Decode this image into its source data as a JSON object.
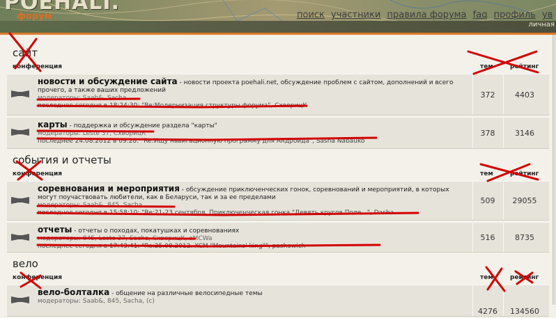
{
  "header": {
    "logo": "POEHALI.",
    "section": "форум",
    "nav": [
      "поиск",
      "участники",
      "правила форума",
      "faq",
      "профиль",
      "ув"
    ],
    "personal": "личная"
  },
  "colors": {
    "accent": "#e07b2a",
    "scribble": "#d20000"
  },
  "columns": {
    "forum": "конференция",
    "topics": "тем",
    "rating": "рейтинг"
  },
  "categories": [
    {
      "title": "сайт",
      "forums": [
        {
          "name": "новости и обсуждение сайта",
          "desc": " - новости проекта poehali.net, обсуждение проблем с сайтом, дополнений и всего прочего, а также ваших предложений",
          "mods": "модераторы: Saab&, Sacha",
          "last": "последнее сегодня в 18:24:30: \"Re:Модернизация структуры форума\", СхворицК",
          "topics": "372",
          "rating": "4403"
        },
        {
          "name": "карты",
          "desc": " - поддержка и обсуждение раздела \"карты\"",
          "mods": "модераторы: Leste 37, СхворицК",
          "last": "последнее 24.08.2012 в 09:28: \"Re:Ищу навигационную программу для Андроида\", Sasha Nabauko",
          "topics": "378",
          "rating": "3146"
        }
      ]
    },
    {
      "title": "события и отчеты",
      "forums": [
        {
          "name": "соревнования и мероприятия",
          "desc": " - обсуждение приключенческих гонок, соревнований и мероприятий, в которых могут поучаствовать любители, как в Беларуси, так и за ее пределами",
          "mods": "модераторы: Saab&, 845, Sacha",
          "last": "последнее сегодня в 15:58:10: \"Re:21-23 сентября. Приключенческая гонка \"Девять кругов Поле...\", Dasha",
          "topics": "509",
          "rating": "29055"
        },
        {
          "name": "отчеты",
          "desc": " - отчеты о походах, покатушках и соревнованиях",
          "mods": "модераторы: 845, Leste 37, Sacha, СхворицК, aMCWa",
          "last": "последнее сегодня в 17:43:41: \"Re:25.08.2012. XCM \"Mountains' king\"\", pashowich",
          "topics": "516",
          "rating": "8735"
        }
      ]
    },
    {
      "title": "вело",
      "forums": [
        {
          "name": "вело-болталка",
          "desc": " - общение на различные велосипедные темы",
          "mods": "модераторы: Saab&, 845, Sacha, (с)",
          "last": "",
          "topics": "4276",
          "rating": "134560"
        }
      ]
    }
  ]
}
